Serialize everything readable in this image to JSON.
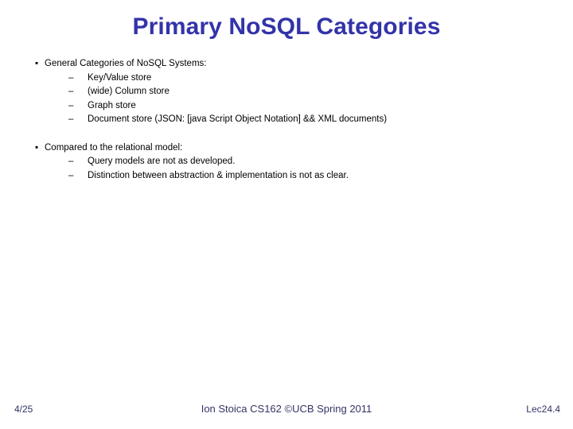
{
  "slide": {
    "title": "Primary NoSQL Categories",
    "title_color": "#3333AA",
    "background_color": "#FFFFFF",
    "body_text_color": "#000000",
    "bullet_marker": "▪",
    "sub_bullet_marker": "–",
    "groups": [
      {
        "heading": "General Categories of NoSQL Systems:",
        "items": [
          "Key/Value store",
          "(wide) Column store",
          "Graph store",
          "Document store  (JSON: [java Script Object Notation] && XML documents)"
        ]
      },
      {
        "heading": "Compared to the relational model:",
        "items": [
          "Query models are not as developed.",
          "Distinction between abstraction & implementation is not as clear."
        ]
      }
    ]
  },
  "footer": {
    "page_number": "4/25",
    "attribution": "Ion Stoica CS162 ©UCB Spring 2011",
    "lecture_tag": "Lec24.4",
    "color": "#333366"
  }
}
